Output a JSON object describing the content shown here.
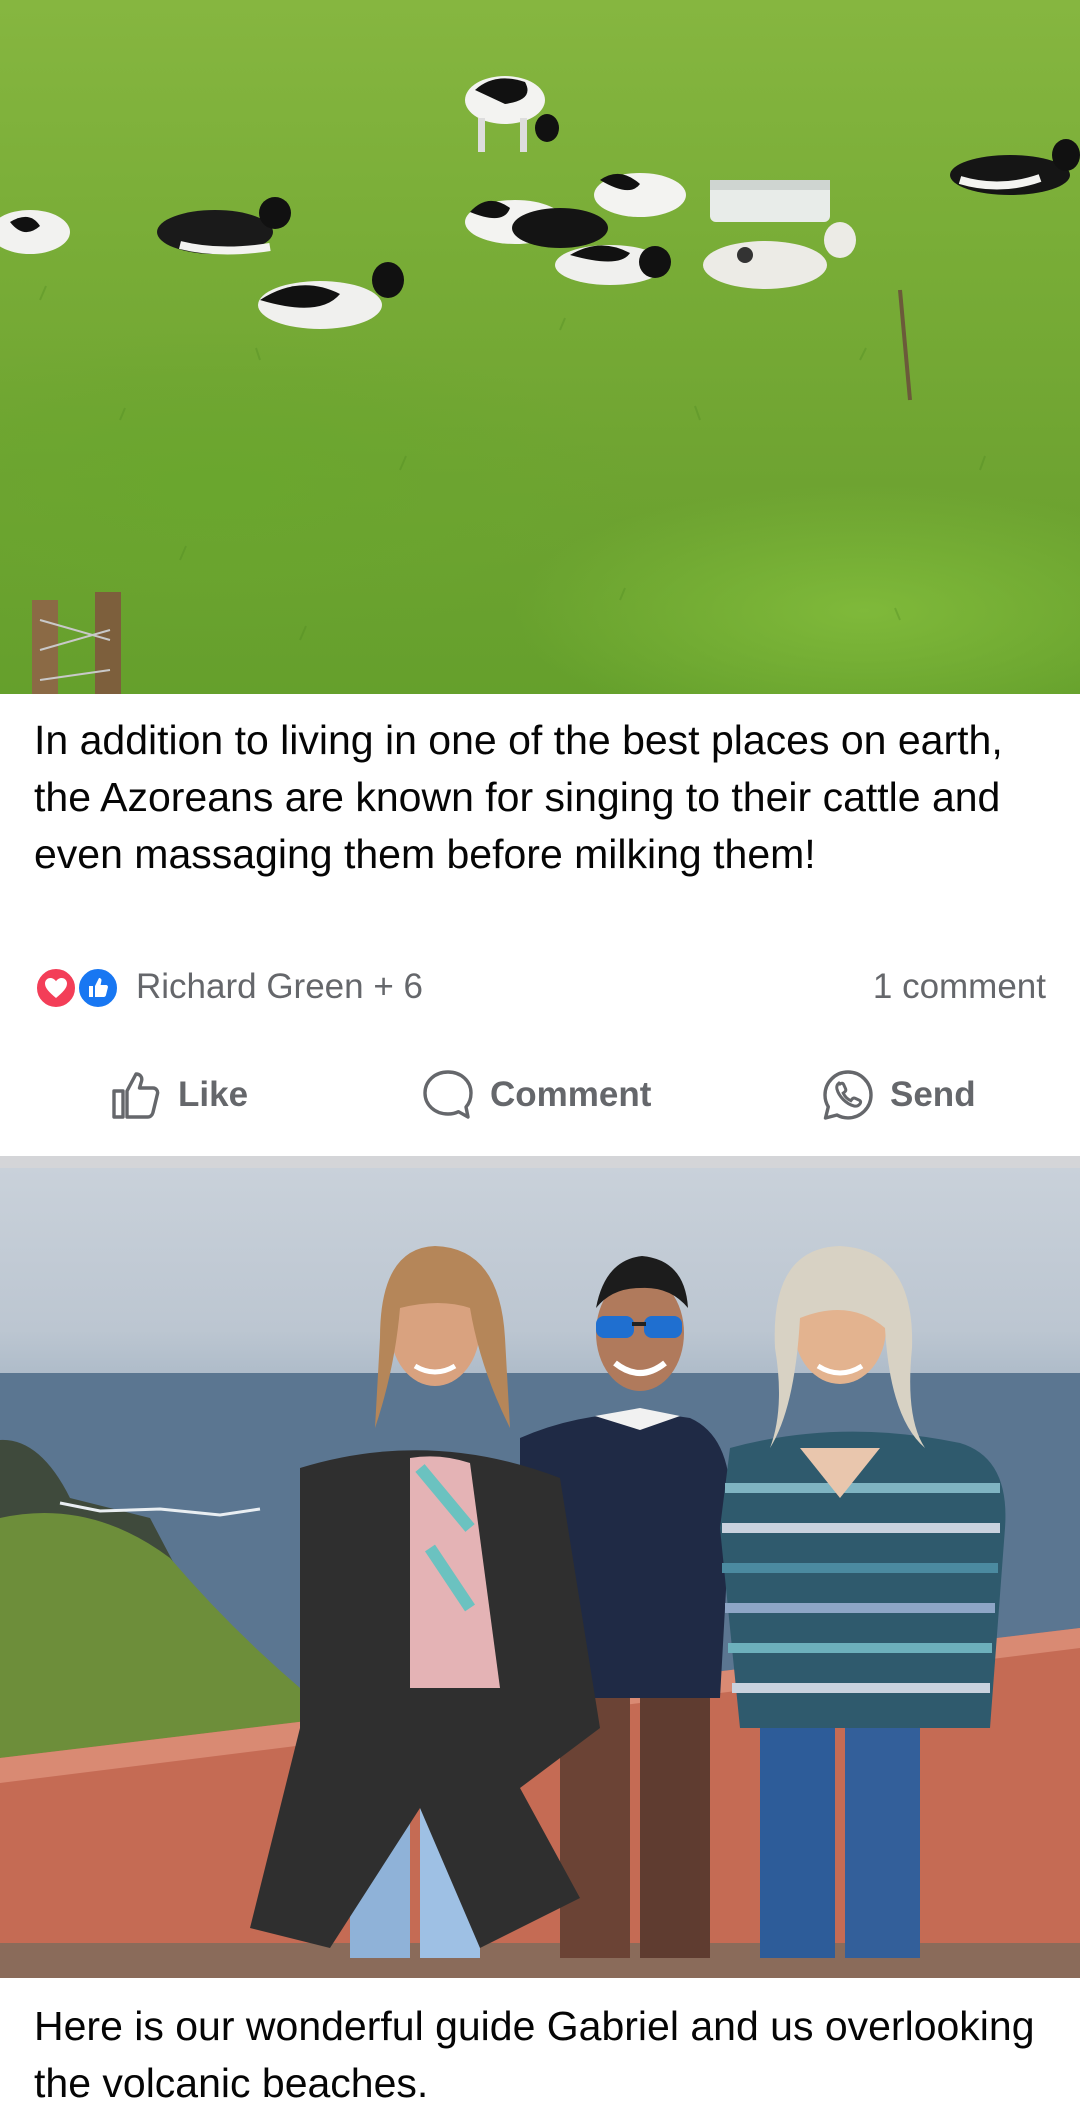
{
  "post_1": {
    "image_alt": "Holstein cows grazing and resting on a green hillside pasture",
    "caption": "In addition to living in one of the best places on earth, the Azoreans are known for singing to their cattle and even massaging them before milking them!",
    "reactions": {
      "types": [
        "heart-icon",
        "like-icon"
      ],
      "names": "Richard Green + 6",
      "comments": "1 comment"
    },
    "actions": {
      "like": "Like",
      "comment": "Comment",
      "send": "Send"
    }
  },
  "post_2": {
    "image_alt": "Two women and a man in sunglasses standing by a terracotta wall overlooking the sea",
    "caption": "Here is our wonderful guide Gabriel and us overlooking the volcanic beaches."
  },
  "colors": {
    "text": "#050505",
    "secondary_text": "#65676b",
    "heart": "#f33e58",
    "like_blue": "#1877f2",
    "separator": "#d4d5d8"
  }
}
